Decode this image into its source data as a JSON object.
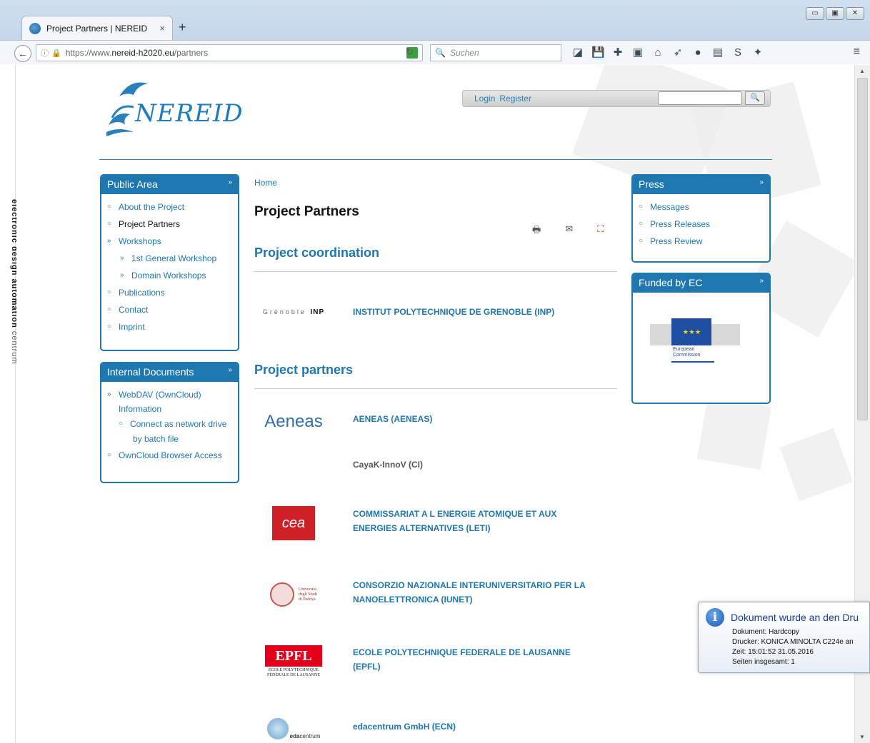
{
  "browser": {
    "tab_title": "Project Partners | NEREID",
    "tab_close": "×",
    "new_tab": "+",
    "url_prefix": "https://www.",
    "url_domain": "nereid-h2020.eu",
    "url_path": "/partners",
    "search_placeholder": "Suchen",
    "window_buttons": [
      "▭",
      "▣",
      "✕"
    ]
  },
  "side_strip": {
    "bold_text": "electronic design automation",
    "light_text": "centrum"
  },
  "header": {
    "logo_text": "NEREID",
    "login_label": "Login",
    "register_label": "Register",
    "search_button": "🔍"
  },
  "public_area": {
    "title": "Public Area",
    "items": [
      {
        "label": "About the Project",
        "mark": "○"
      },
      {
        "label": "Project Partners",
        "mark": "○"
      },
      {
        "label": "Workshops",
        "mark": "»"
      },
      {
        "label": "1st General Workshop",
        "mark": "»"
      },
      {
        "label": "Domain Workshops",
        "mark": "»"
      },
      {
        "label": "Publications",
        "mark": "○"
      },
      {
        "label": "Contact",
        "mark": "○"
      },
      {
        "label": "Imprint",
        "mark": "○"
      }
    ]
  },
  "internal_docs": {
    "title": "Internal Documents",
    "items": [
      {
        "label": "WebDAV (OwnCloud)",
        "mark": "»"
      },
      {
        "label": "Information",
        "mark": ""
      },
      {
        "label": "Connect as network drive",
        "mark": "○"
      },
      {
        "label": "by batch file",
        "mark": ""
      },
      {
        "label": "OwnCloud Browser Access",
        "mark": "○"
      }
    ]
  },
  "press": {
    "title": "Press",
    "items": [
      {
        "label": "Messages",
        "mark": "○"
      },
      {
        "label": "Press Releases",
        "mark": "○"
      },
      {
        "label": "Press Review",
        "mark": "○"
      }
    ]
  },
  "funded": {
    "title": "Funded by EC",
    "caption_line1": "European",
    "caption_line2": "Commission"
  },
  "main": {
    "breadcrumb": "Home",
    "title": "Project Partners",
    "tools": [
      "🖶",
      "✉",
      "⛶"
    ],
    "coordination_heading": "Project coordination",
    "partners_heading": "Project partners",
    "coordinator": {
      "name": "INSTITUT POLYTECHNIQUE DE GRENOBLE (INP)",
      "logo_text": "Grenoble",
      "logo_bold": "INP"
    },
    "partners": [
      {
        "name_line1": "AENEAS (AENEAS)",
        "name_line2": "",
        "logo": "Aeneas"
      },
      {
        "name_line1": "CayaK-InnoV (CI)",
        "name_line2": "",
        "logo": ""
      },
      {
        "name_line1": "COMMISSARIAT A L ENERGIE ATOMIQUE ET AUX",
        "name_line2": "ENERGIES ALTERNATIVES (LETI)",
        "logo": "cea"
      },
      {
        "name_line1": "CONSORZIO NAZIONALE INTERUNIVERSITARIO PER LA",
        "name_line2": "NANOELETTRONICA (IUNET)",
        "logo": ""
      },
      {
        "name_line1": "ECOLE POLYTECHNIQUE FEDERALE DE LAUSANNE",
        "name_line2": "(EPFL)",
        "logo": "EPFL"
      },
      {
        "name_line1": "edacentrum GmbH (ECN)",
        "name_line2": "",
        "logo": "edacentrum"
      }
    ],
    "padova_logo": [
      "Università",
      "degli Studi",
      "di Padova"
    ],
    "epfl_sub": [
      "ÉCOLE POLYTECHNIQUE",
      "FÉDÉRALE DE LAUSANNE"
    ],
    "eda_bold": "eda",
    "eda_light": "centrum"
  },
  "notification": {
    "title": "Dokument wurde an den Dru",
    "lines": [
      "Dokument: Hardcopy",
      "Drucker: KONICA MINOLTA C224e an",
      "Zeit: 15:01:52 31.05.2016",
      "Seiten insgesamt: 1"
    ]
  }
}
